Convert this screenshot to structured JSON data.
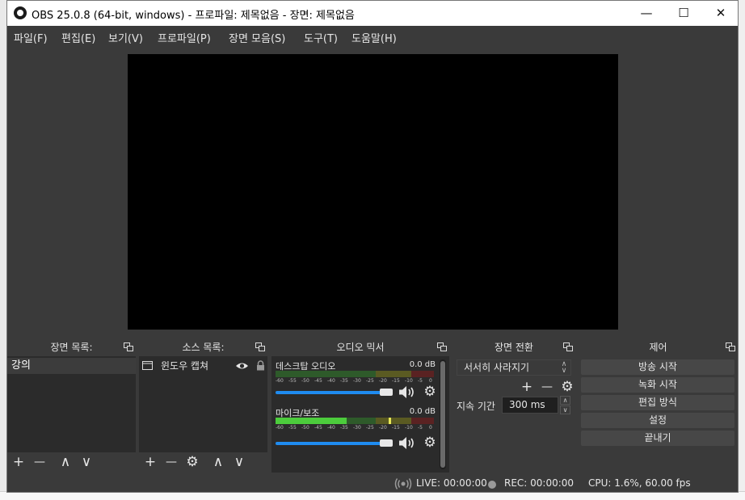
{
  "window": {
    "title": "OBS 25.0.8 (64-bit, windows) - 프로파일: 제목없음 - 장면: 제목없음",
    "minimize": "—",
    "maximize": "☐",
    "close": "✕"
  },
  "menu": [
    "파일(F)",
    "편집(E)",
    "보기(V)",
    "프로파일(P)",
    "장면 모음(S)",
    "도구(T)",
    "도움말(H)"
  ],
  "docks": {
    "scenes": {
      "title": "장면 목록:",
      "items": [
        "강의"
      ]
    },
    "sources": {
      "title": "소스 목록:",
      "items": [
        "윈도우 캡쳐"
      ]
    },
    "mixer": {
      "title": "오디오 믹서",
      "channels": [
        {
          "name": "데스크탑 오디오",
          "db": "0.0 dB"
        },
        {
          "name": "마이크/보조",
          "db": "0.0 dB"
        }
      ],
      "ticks": [
        "-60",
        "-55",
        "-50",
        "-45",
        "-40",
        "-35",
        "-30",
        "-25",
        "-20",
        "-15",
        "-10",
        "-5",
        "0"
      ]
    },
    "transitions": {
      "title": "장면 전환",
      "selected": "서서히 사라지기",
      "duration_label": "지속 기간",
      "duration_value": "300 ms"
    },
    "controls": {
      "title": "제어",
      "buttons": [
        "방송 시작",
        "녹화 시작",
        "편집 방식",
        "설정",
        "끝내기"
      ]
    }
  },
  "toolbar": {
    "add": "+",
    "remove": "—",
    "up": "∧",
    "down": "∨",
    "settings": "⚙"
  },
  "status": {
    "live": "LIVE: 00:00:00",
    "rec": "REC: 00:00:00",
    "cpu": "CPU: 1.6%, 60.00 fps"
  },
  "colors": {
    "meter_green": "#4ccc3c",
    "meter_yellow": "#c8c83a",
    "meter_red": "#c83a3a",
    "slider_blue": "#1f8cf0"
  }
}
